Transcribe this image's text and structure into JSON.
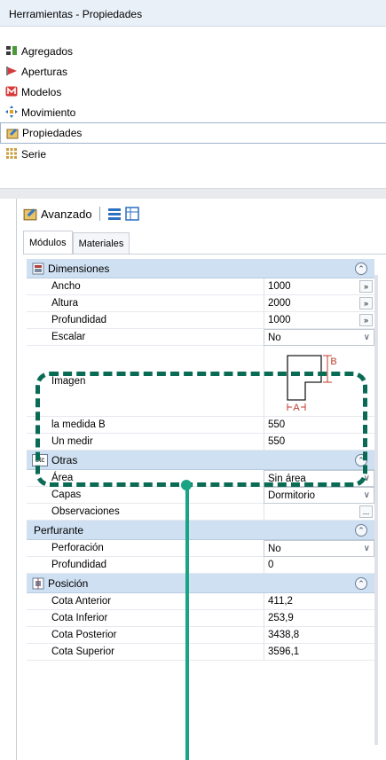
{
  "window": {
    "title": "Herramientas - Propiedades"
  },
  "nav": {
    "items": [
      {
        "label": "Agregados",
        "icon": "aggregates-icon"
      },
      {
        "label": "Aperturas",
        "icon": "openings-icon"
      },
      {
        "label": "Modelos",
        "icon": "models-icon"
      },
      {
        "label": "Movimiento",
        "icon": "movement-icon"
      },
      {
        "label": "Propiedades",
        "icon": "properties-icon",
        "active": true
      },
      {
        "label": "Serie",
        "icon": "series-icon"
      }
    ]
  },
  "toolbar": {
    "advanced_label": "Avanzado"
  },
  "tabs": [
    {
      "label": "Módulos",
      "active": true
    },
    {
      "label": "Materiales",
      "active": false
    }
  ],
  "groups": {
    "dimensiones": {
      "title": "Dimensiones",
      "rows": {
        "ancho": {
          "label": "Ancho",
          "value": "1000"
        },
        "altura": {
          "label": "Altura",
          "value": "2000"
        },
        "profundidad": {
          "label": "Profundidad",
          "value": "1000"
        },
        "escalar": {
          "label": "Escalar",
          "value": "No"
        },
        "imagen": {
          "label": "Imagen",
          "marker_a": "A",
          "marker_b": "B"
        },
        "medida_b": {
          "label": "la medida B",
          "value": "550"
        },
        "un_medir": {
          "label": "Un medir",
          "value": "550"
        }
      }
    },
    "otras": {
      "title": "Otras",
      "icon_text": "etc",
      "rows": {
        "area": {
          "label": "Área",
          "value": "Sin área"
        },
        "capas": {
          "label": "Capas",
          "value": "Dormitorio"
        },
        "observaciones": {
          "label": "Observaciones",
          "value": ""
        }
      }
    },
    "perfurante": {
      "title": "Perfurante",
      "rows": {
        "perforacion": {
          "label": "Perforación",
          "value": "No"
        },
        "profundidad": {
          "label": "Profundidad",
          "value": "0"
        }
      }
    },
    "posicion": {
      "title": "Posición",
      "rows": {
        "cota_anterior": {
          "label": "Cota Anterior",
          "value": "411,2"
        },
        "cota_inferior": {
          "label": "Cota Inferior",
          "value": "253,9"
        },
        "cota_posterior": {
          "label": "Cota Posterior",
          "value": "3438,8"
        },
        "cota_superior": {
          "label": "Cota Superior",
          "value": "3596,1"
        }
      }
    }
  },
  "glyphs": {
    "expand_button": "»",
    "ellipsis_button": "...",
    "collapse": "⌃",
    "dropdown": "∨"
  },
  "colors": {
    "group_header": "#cfe0f2",
    "highlight_dash": "#0a6b54",
    "connector": "#1aa384",
    "dimension_marker": "#c0392b"
  }
}
